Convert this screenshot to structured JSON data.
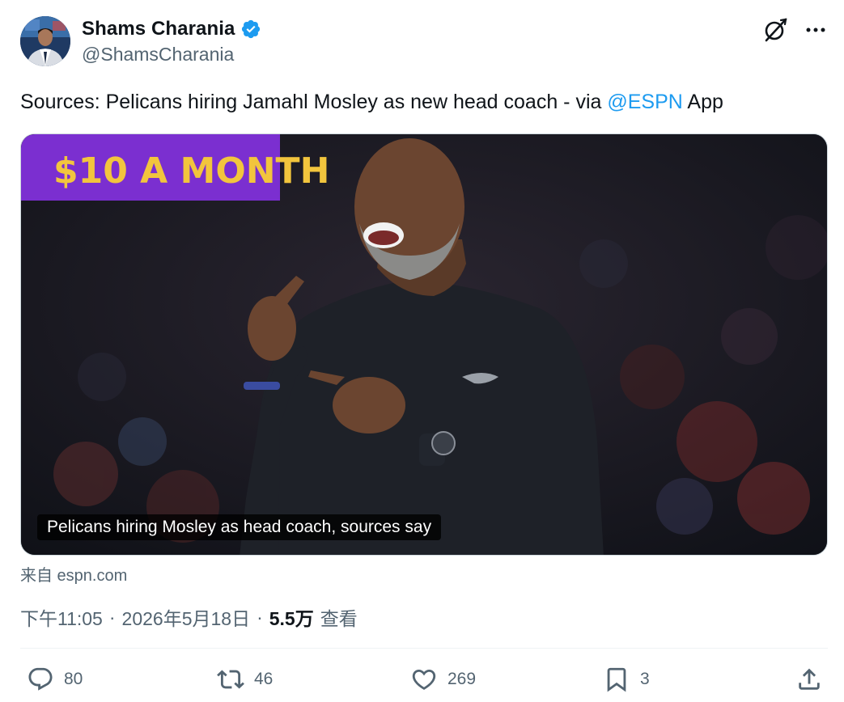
{
  "author": {
    "display_name": "Shams Charania",
    "handle": "@ShamsCharania",
    "verified": true
  },
  "icons": {
    "verified": "verified-badge-icon",
    "grok": "grok-icon",
    "more": "more-icon",
    "reply": "reply-icon",
    "retweet": "retweet-icon",
    "like": "like-icon",
    "bookmark": "bookmark-icon",
    "share": "share-icon"
  },
  "tweet": {
    "text_before": "Sources: Pelicans hiring Jamahl Mosley as new head coach - via ",
    "mention": "@ESPN",
    "text_after": " App"
  },
  "media": {
    "caption": "Pelicans hiring Mosley as head coach, sources say",
    "arena_sign": "$10 A MONTH",
    "source": "来自 espn.com"
  },
  "meta": {
    "time": "下午11:05",
    "separator": "·",
    "date": "2026年5月18日",
    "views_count": "5.5万",
    "views_label": "查看"
  },
  "stats": {
    "replies": "80",
    "retweets": "46",
    "likes": "269",
    "bookmarks": "3"
  },
  "colors": {
    "accent": "#1d9bf0",
    "text_primary": "#0f1419",
    "text_secondary": "#536471",
    "divider": "#eff3f4",
    "sign_purple": "#7b2fd0",
    "sign_text": "#f2c53d"
  }
}
